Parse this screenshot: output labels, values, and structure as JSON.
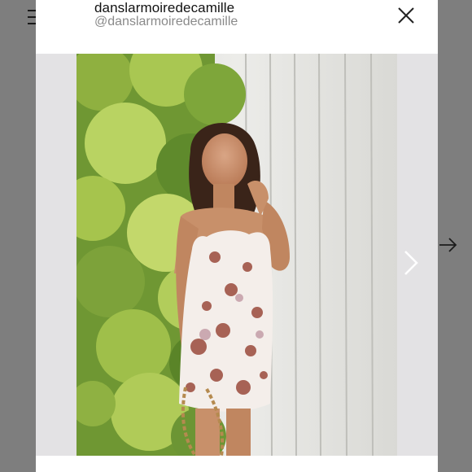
{
  "account": {
    "name": "danslarmoiredecamille",
    "handle": "@danslarmoiredecamille"
  },
  "icons": {
    "menu": "hamburger-menu-icon",
    "close": "close-icon",
    "next_image": "chevron-right-icon",
    "next_post": "arrow-right-icon"
  },
  "colors": {
    "backdrop": "#7e7e7e",
    "modal": "#ffffff",
    "photo_frame": "#e3e2e4",
    "dress": "#f4eeea",
    "floral_print": "#9a4a3c",
    "ivy_light": "#b6cf5f",
    "ivy_dark": "#5e8a2a",
    "wood_wall": "#e4e4e1"
  }
}
